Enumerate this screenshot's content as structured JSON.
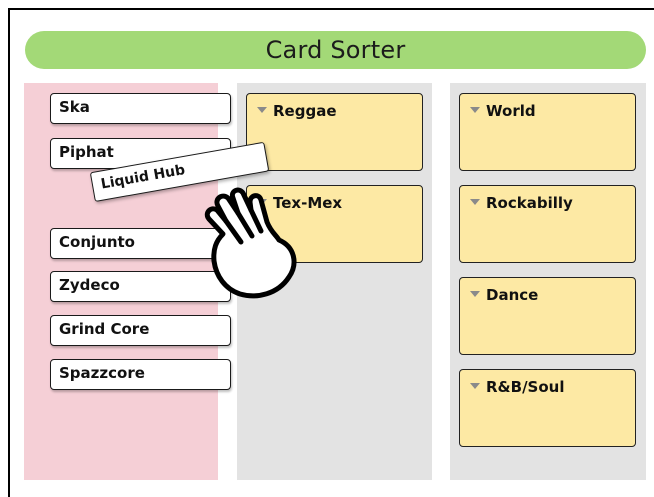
{
  "app": {
    "title": "Card Sorter"
  },
  "source_cards": [
    {
      "label": "Ska"
    },
    {
      "label": "Piphat"
    },
    {
      "label": "Conjunto"
    },
    {
      "label": "Zydeco"
    },
    {
      "label": "Grind Core"
    },
    {
      "label": "Spazzcore"
    }
  ],
  "dragged_card": {
    "label": "Liquid Hub"
  },
  "groups_column_a": [
    {
      "label": "Reggae"
    },
    {
      "label": "Tex-Mex"
    }
  ],
  "groups_column_b": [
    {
      "label": "World"
    },
    {
      "label": "Rockabilly"
    },
    {
      "label": "Dance"
    },
    {
      "label": "R&B/Soul"
    }
  ],
  "icons": {
    "cursor": "grab-hand-icon",
    "group_toggle": "triangle-down-icon"
  },
  "colors": {
    "title_bar": "#a3d977",
    "source_column": "#f5cfd6",
    "group_column": "#e3e3e3",
    "group_card": "#fde9a4"
  }
}
